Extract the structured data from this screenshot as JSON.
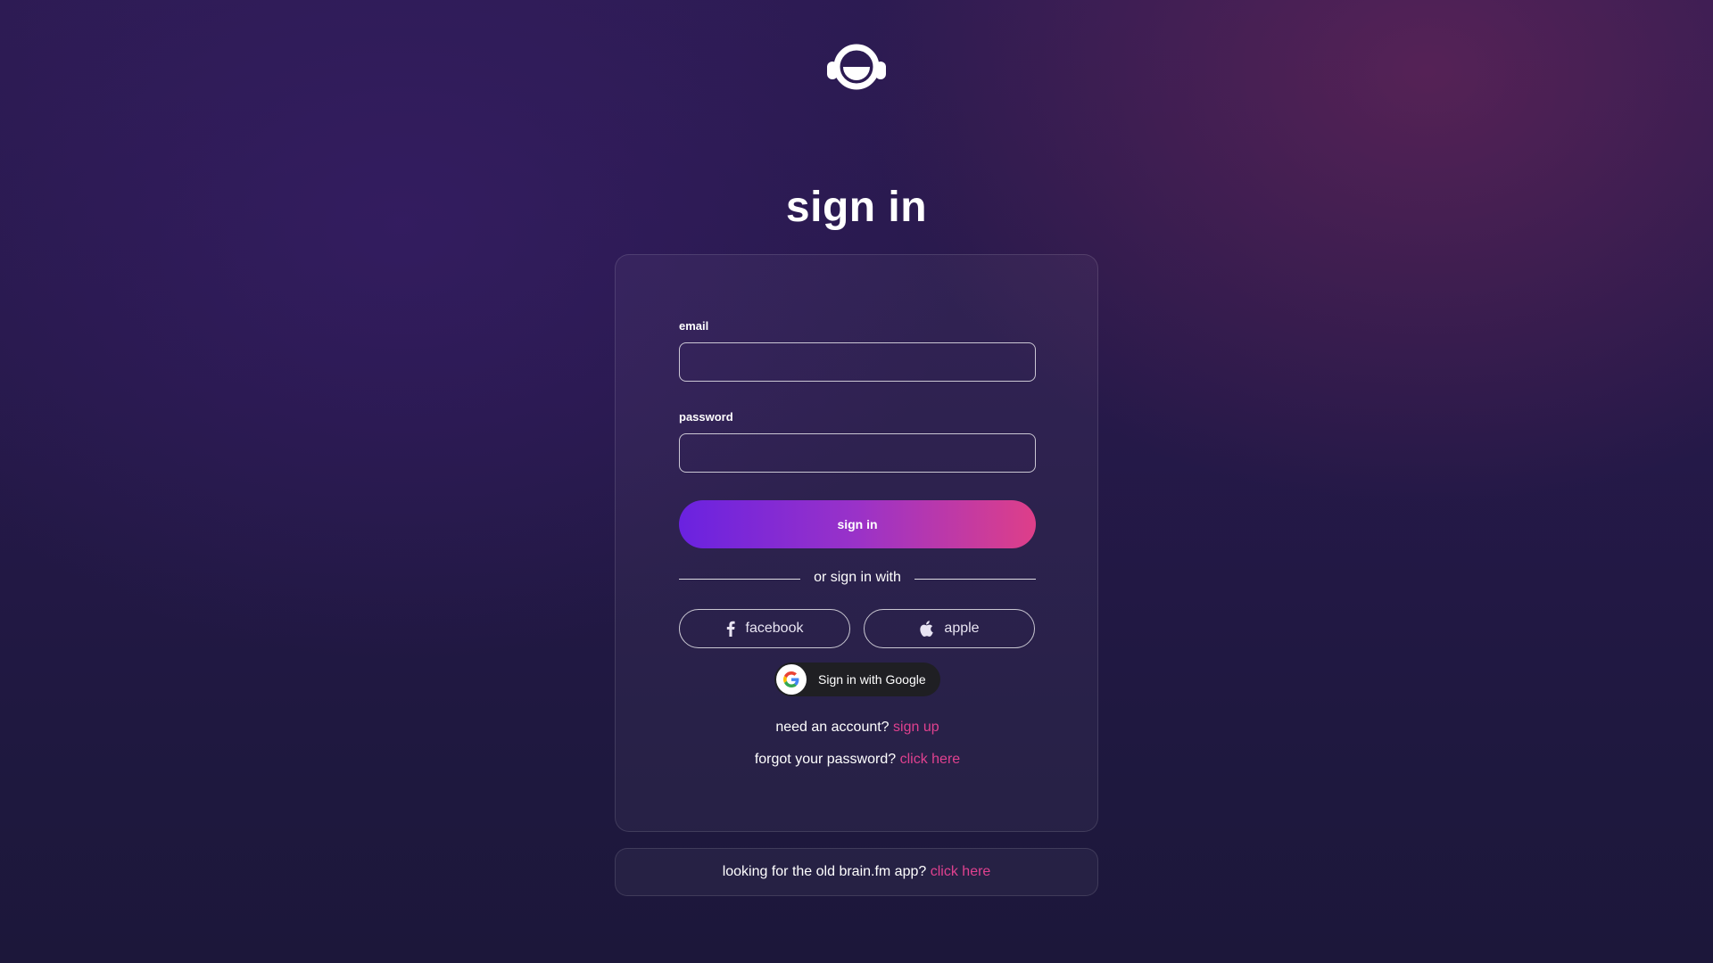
{
  "page": {
    "title": "sign in"
  },
  "form": {
    "email_label": "email",
    "email_value": "",
    "email_placeholder": "",
    "password_label": "password",
    "password_value": "",
    "password_placeholder": "",
    "submit_label": "sign in"
  },
  "social": {
    "divider_text": "or sign in with",
    "facebook_label": "facebook",
    "facebook_icon": "facebook-icon",
    "apple_label": "apple",
    "apple_icon": "apple-icon",
    "google_label": "Sign in with Google",
    "google_icon": "google-icon"
  },
  "links": {
    "signup_prompt": "need an account?",
    "signup_link": "sign up",
    "forgot_prompt": "forgot your password?",
    "forgot_link": "click here"
  },
  "footer": {
    "prompt": "looking for the old brain.fm app?",
    "link": "click here"
  },
  "colors": {
    "accent_pink": "#e0418f",
    "gradient_start": "#6a22e0",
    "gradient_end": "#de3f89",
    "background": "#26194a"
  }
}
